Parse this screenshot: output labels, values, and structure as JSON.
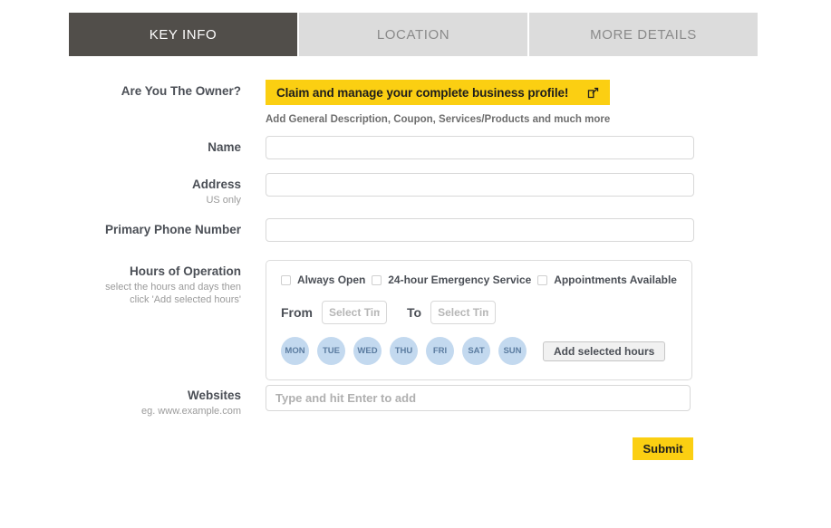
{
  "tabs": [
    {
      "label": "KEY INFO",
      "active": true
    },
    {
      "label": "LOCATION",
      "active": false
    },
    {
      "label": "MORE DETAILS",
      "active": false
    }
  ],
  "form": {
    "owner": {
      "label": "Are You The Owner?",
      "button_text": "Claim and manage your complete business profile!",
      "button_icon": "external-link-icon",
      "note": "Add General Description, Coupon, Services/Products and much more"
    },
    "name": {
      "label": "Name",
      "value": "",
      "placeholder": ""
    },
    "address": {
      "label": "Address",
      "sublabel": "US only",
      "value": "",
      "placeholder": ""
    },
    "phone": {
      "label": "Primary Phone Number",
      "value": "",
      "placeholder": ""
    },
    "hours": {
      "label": "Hours of Operation",
      "sublabel_line1": "select the hours and days then",
      "sublabel_line2": "click 'Add selected hours'",
      "checkboxes": [
        {
          "label": "Always Open",
          "checked": false
        },
        {
          "label": "24-hour Emergency Service",
          "checked": false
        },
        {
          "label": "Appointments Available",
          "checked": false
        }
      ],
      "from_label": "From",
      "from_placeholder": "Select Tim",
      "from_value": "",
      "to_label": "To",
      "to_placeholder": "Select Tim",
      "to_value": "",
      "days": [
        "MON",
        "TUE",
        "WED",
        "THU",
        "FRI",
        "SAT",
        "SUN"
      ],
      "add_button": "Add selected hours"
    },
    "websites": {
      "label": "Websites",
      "sublabel": "eg. www.example.com",
      "value": "",
      "placeholder": "Type and hit Enter to add"
    },
    "submit": {
      "label": "Submit"
    }
  },
  "colors": {
    "accent_yellow": "#fbcf12",
    "tab_active_bg": "#514e4a",
    "tab_inactive_bg": "#dcdcdc",
    "day_pill_bg": "#c3d9ef",
    "day_pill_text": "#5b7ca0",
    "label_text": "#4b4f56",
    "sublabel_text": "#9b9b9b"
  }
}
